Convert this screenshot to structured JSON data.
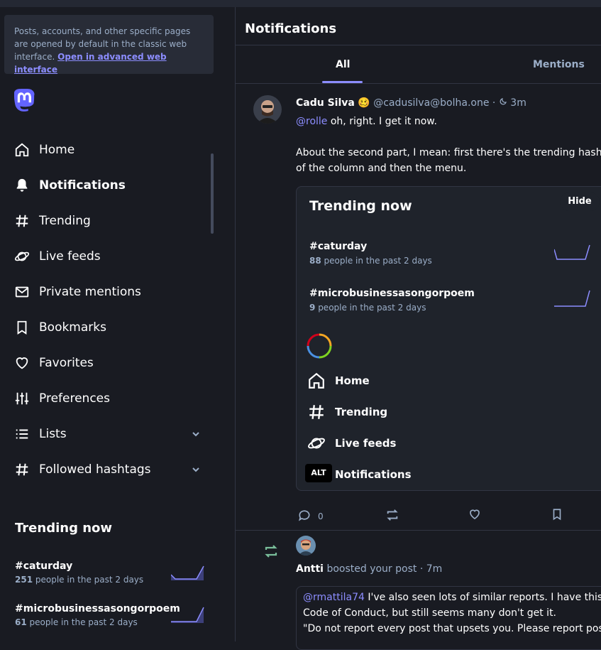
{
  "notice": {
    "text": "Posts, accounts, and other specific pages are opened by default in the classic web interface.",
    "link": "Open in advanced web interface"
  },
  "nav": [
    {
      "label": "Home",
      "icon": "home-icon"
    },
    {
      "label": "Notifications",
      "icon": "bell-icon",
      "active": true
    },
    {
      "label": "Trending",
      "icon": "hashtag-icon"
    },
    {
      "label": "Live feeds",
      "icon": "planet-icon"
    },
    {
      "label": "Private mentions",
      "icon": "mail-icon"
    },
    {
      "label": "Bookmarks",
      "icon": "bookmark-icon"
    },
    {
      "label": "Favorites",
      "icon": "heart-icon"
    },
    {
      "label": "Preferences",
      "icon": "sliders-icon"
    },
    {
      "label": "Lists",
      "icon": "list-icon"
    },
    {
      "label": "Followed hashtags",
      "icon": "hashtag-icon"
    }
  ],
  "trending": {
    "title": "Trending now",
    "items": [
      {
        "tag": "#caturday",
        "count": "251",
        "suffix": "people in the past 2 days"
      },
      {
        "tag": "#microbusinessasongorpoem",
        "count": "61",
        "suffix": "people in the past 2 days"
      }
    ]
  },
  "column": {
    "title": "Notifications",
    "tabs": [
      "All",
      "Mentions"
    ]
  },
  "status": {
    "name": "Cadu Silva",
    "emoji": "🥴",
    "acct": "@cadusilva@bolha.one",
    "time": "3m",
    "mention": "@rolle",
    "line1": " oh, right. I get it now.",
    "line2": "About the second part, I mean: first there's the trending hashtags",
    "line3": "of the column and then the menu.",
    "replies": "0",
    "media": {
      "hide": "Hide",
      "alt": "ALT",
      "title": "Trending now",
      "items": [
        {
          "tag": "#caturday",
          "count": "88",
          "suffix": "people in the past 2 days"
        },
        {
          "tag": "#microbusinessasongorpoem",
          "count": "9",
          "suffix": "people in the past 2 days"
        }
      ],
      "nav": [
        "Home",
        "Trending",
        "Live feeds",
        "Notifications"
      ]
    }
  },
  "boost": {
    "name": "Antti",
    "action": "boosted your post",
    "time": "7m",
    "mention": "@rmattila74",
    "line1": " I've also seen lots of similar reports. I have this in",
    "line2": "Code of Conduct, but still seems many don't get it.",
    "line3": "\"Do not report every post that upsets you. Please report posts"
  },
  "colors": {
    "accent": "#8c8dff",
    "boost": "#79bd9a",
    "bg": "#191b22",
    "panel": "#282c37"
  }
}
